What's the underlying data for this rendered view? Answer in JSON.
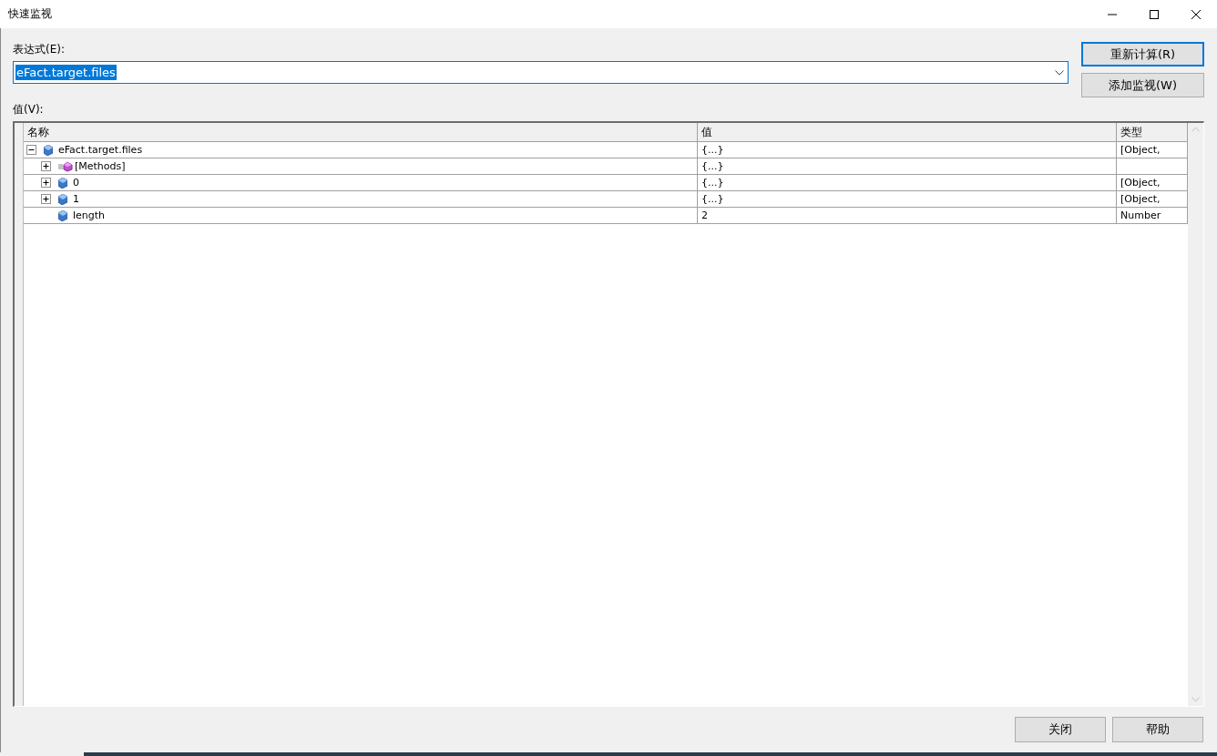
{
  "window": {
    "title": "快速监视"
  },
  "expression": {
    "label": "表达式(E):",
    "value": "eFact.target.files",
    "text_selected": true
  },
  "side_buttons": [
    {
      "label": "重新计算(R)",
      "default": true
    },
    {
      "label": "添加监视(W)",
      "default": false
    }
  ],
  "value_label": "值(V):",
  "table": {
    "columns": [
      "名称",
      "值",
      "类型"
    ],
    "rows": [
      {
        "name": "eFact.target.files",
        "value": "{...}",
        "type": "[Object,",
        "kind": "property",
        "expanded": true,
        "children": [
          {
            "name": "[Methods]",
            "value": "{...}",
            "kind": "methods",
            "expanded": false
          },
          {
            "name": "0",
            "value": "{...}",
            "type": "[Object,",
            "kind": "property",
            "expanded": false
          },
          {
            "name": "1",
            "value": "{...}",
            "type": "[Object,",
            "kind": "property",
            "expanded": false
          },
          {
            "name": "length",
            "value": "2",
            "type": "Number",
            "kind": "property"
          }
        ]
      }
    ]
  },
  "bottom_buttons": [
    {
      "label": "关闭"
    },
    {
      "label": "帮助"
    }
  ]
}
